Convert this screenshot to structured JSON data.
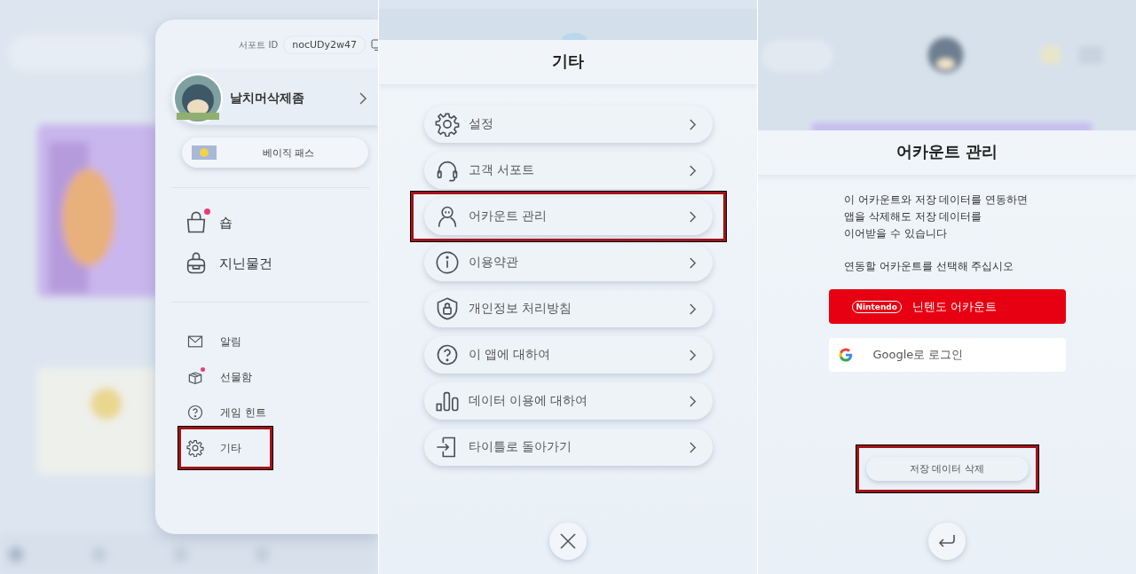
{
  "drawer": {
    "support_id_label": "서포트 ID",
    "support_id": "nocUDy2w47",
    "profile_name": "날치머삭제좀",
    "pass_label": "베이직 패스",
    "main_items": [
      {
        "label": "숍",
        "kind": "bag",
        "notification_dot": true
      },
      {
        "label": "지닌물건",
        "kind": "backpack",
        "notification_dot": false
      }
    ],
    "sub_items": [
      {
        "label": "알림",
        "kind": "mail",
        "notification_dot": false,
        "highlighted": false
      },
      {
        "label": "선물함",
        "kind": "gift",
        "notification_dot": true,
        "highlighted": false
      },
      {
        "label": "게임 힌트",
        "kind": "question",
        "notification_dot": false,
        "highlighted": false
      },
      {
        "label": "기타",
        "kind": "gear",
        "notification_dot": false,
        "highlighted": true
      }
    ]
  },
  "other_menu": {
    "title": "기타",
    "items": [
      {
        "label": "설정",
        "kind": "gear",
        "highlighted": false
      },
      {
        "label": "고객 서포트",
        "kind": "headset",
        "highlighted": false
      },
      {
        "label": "어카운트 관리",
        "kind": "person",
        "highlighted": true
      },
      {
        "label": "이용약관",
        "kind": "info",
        "highlighted": false
      },
      {
        "label": "개인정보 처리방침",
        "kind": "shield",
        "highlighted": false
      },
      {
        "label": "이 앱에 대하여",
        "kind": "question",
        "highlighted": false
      },
      {
        "label": "데이터 이용에 대하여",
        "kind": "bars",
        "highlighted": false
      },
      {
        "label": "타이틀로 돌아가기",
        "kind": "exit",
        "highlighted": false
      }
    ]
  },
  "account_screen": {
    "title": "어카운트 관리",
    "message": [
      "이 어카운트와 저장 데이터를 연동하면",
      "앱을 삭제해도 저장 데이터를",
      "이어받을 수 있습니다"
    ],
    "prompt": "연동할 어카운트를 선택해 주십시오",
    "nintendo_button": {
      "logo": "Nintendo",
      "label": "닌텐도 어카운트"
    },
    "google_button": {
      "label": "Google로 로그인"
    },
    "delete_button": {
      "label": "저장 데이터 삭제",
      "highlighted": true
    }
  }
}
